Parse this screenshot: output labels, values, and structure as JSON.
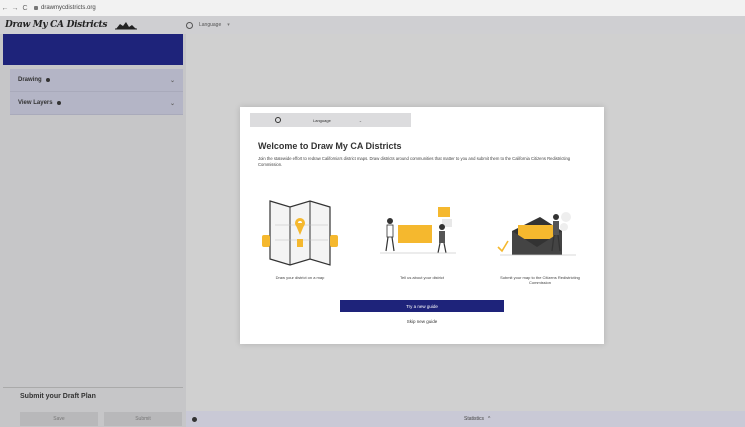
{
  "browser": {
    "back": "←",
    "forward": "→",
    "reload": "C",
    "url": "drawmycdistricts.org"
  },
  "app": {
    "brand": "Draw My CA Districts"
  },
  "sidebar": {
    "items": [
      {
        "label": "Drawing"
      },
      {
        "label": "View Layers"
      }
    ],
    "submit_title": "Submit your Draft Plan",
    "buttons": {
      "save": "Save",
      "submit": "Submit"
    }
  },
  "topbar": {
    "language": "Language",
    "caret": "▾"
  },
  "bottombar": {
    "stats_label": "Statistics",
    "stats_caret": "^"
  },
  "modal": {
    "language": "Language",
    "caret": "⌄",
    "title": "Welcome to Draw My CA Districts",
    "text": "Join the statewide effort to redraw California's district maps. Draw districts around communities that matter to you and submit them to the California Citizens Redistricting Commission.",
    "steps": [
      {
        "caption": "Draw your district on a map"
      },
      {
        "caption": "Tell us about your district"
      },
      {
        "caption": "Submit your map to the Citizens Redistricting Commission"
      }
    ],
    "primary_button": "Try a new guide",
    "skip": "Skip new guide"
  },
  "colors": {
    "primary_navy": "#1e237a",
    "accent_yellow": "#f5b82e",
    "panel_lavender": "#b4b5c6",
    "background": "#d0d0d0"
  }
}
